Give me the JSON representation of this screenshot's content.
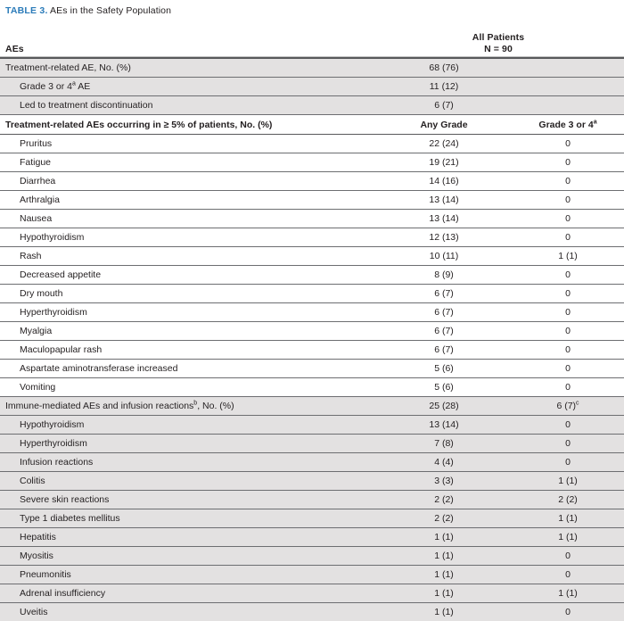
{
  "caption": {
    "label": "TABLE 3.",
    "text": "AEs in the Safety Population",
    "label_color": "#2b7bb9"
  },
  "header": {
    "row_label": "AEs",
    "all_patients_line1": "All Patients",
    "all_patients_line2": "N = 90",
    "any_grade": "Any Grade",
    "grade_3_or_4": "Grade 3 or 4",
    "grade_3_or_4_sup": "a"
  },
  "sections": [
    {
      "name": "overall-summary",
      "shaded": true,
      "rows": [
        {
          "label": "Treatment-related AE, No. (%)",
          "indent": false,
          "any": "68 (76)",
          "g34": ""
        },
        {
          "label": "Grade 3 or 4",
          "label_sup": "a",
          "label_suffix": " AE",
          "indent": true,
          "any": "11 (12)",
          "g34": ""
        },
        {
          "label": "Led to treatment discontinuation",
          "indent": true,
          "any": "6 (7)",
          "g34": ""
        }
      ]
    },
    {
      "name": "treatment-related-aes",
      "shaded": false,
      "heading": "Treatment-related AEs occurring in ≥ 5% of patients, No. (%)",
      "rows": [
        {
          "label": "Pruritus",
          "indent": true,
          "any": "22 (24)",
          "g34": "0"
        },
        {
          "label": "Fatigue",
          "indent": true,
          "any": "19 (21)",
          "g34": "0"
        },
        {
          "label": "Diarrhea",
          "indent": true,
          "any": "14 (16)",
          "g34": "0"
        },
        {
          "label": "Arthralgia",
          "indent": true,
          "any": "13 (14)",
          "g34": "0"
        },
        {
          "label": "Nausea",
          "indent": true,
          "any": "13 (14)",
          "g34": "0"
        },
        {
          "label": "Hypothyroidism",
          "indent": true,
          "any": "12 (13)",
          "g34": "0"
        },
        {
          "label": "Rash",
          "indent": true,
          "any": "10 (11)",
          "g34": "1 (1)"
        },
        {
          "label": "Decreased appetite",
          "indent": true,
          "any": "8 (9)",
          "g34": "0"
        },
        {
          "label": "Dry mouth",
          "indent": true,
          "any": "6 (7)",
          "g34": "0"
        },
        {
          "label": "Hyperthyroidism",
          "indent": true,
          "any": "6 (7)",
          "g34": "0"
        },
        {
          "label": "Myalgia",
          "indent": true,
          "any": "6 (7)",
          "g34": "0"
        },
        {
          "label": "Maculopapular rash",
          "indent": true,
          "any": "6 (7)",
          "g34": "0"
        },
        {
          "label": "Aspartate aminotransferase increased",
          "indent": true,
          "any": "5 (6)",
          "g34": "0"
        },
        {
          "label": "Vomiting",
          "indent": true,
          "any": "5 (6)",
          "g34": "0"
        }
      ]
    },
    {
      "name": "immune-mediated-aes",
      "shaded": true,
      "rows": [
        {
          "label": "Immune-mediated AEs and infusion reactions",
          "label_sup": "b",
          "label_suffix": ", No. (%)",
          "indent": false,
          "any": "25 (28)",
          "g34": "6 (7)",
          "g34_sup": "c"
        },
        {
          "label": "Hypothyroidism",
          "indent": true,
          "any": "13 (14)",
          "g34": "0"
        },
        {
          "label": "Hyperthyroidism",
          "indent": true,
          "any": "7 (8)",
          "g34": "0"
        },
        {
          "label": "Infusion reactions",
          "indent": true,
          "any": "4 (4)",
          "g34": "0"
        },
        {
          "label": "Colitis",
          "indent": true,
          "any": "3 (3)",
          "g34": "1 (1)"
        },
        {
          "label": "Severe skin reactions",
          "indent": true,
          "any": "2 (2)",
          "g34": "2 (2)"
        },
        {
          "label": "Type 1 diabetes mellitus",
          "indent": true,
          "any": "2 (2)",
          "g34": "1 (1)"
        },
        {
          "label": "Hepatitis",
          "indent": true,
          "any": "1 (1)",
          "g34": "1 (1)"
        },
        {
          "label": "Myositis",
          "indent": true,
          "any": "1 (1)",
          "g34": "0"
        },
        {
          "label": "Pneumonitis",
          "indent": true,
          "any": "1 (1)",
          "g34": "0"
        },
        {
          "label": "Adrenal insufficiency",
          "indent": true,
          "any": "1 (1)",
          "g34": "1 (1)"
        },
        {
          "label": "Uveitis",
          "indent": true,
          "any": "1 (1)",
          "g34": "0"
        }
      ]
    }
  ]
}
